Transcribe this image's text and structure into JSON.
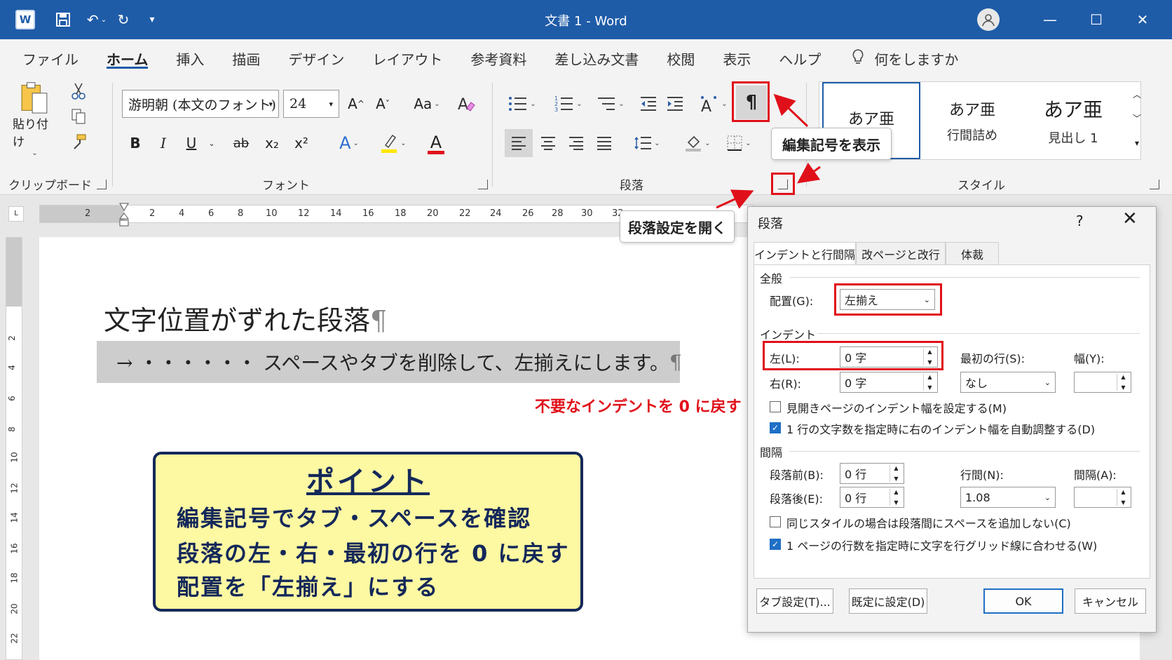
{
  "titlebar": {
    "title": "文書 1  -  Word",
    "logo": "W",
    "undo": "↶",
    "redo": "↻",
    "qat_more": "▾",
    "minimize": "—",
    "maximize": "☐",
    "close": "✕"
  },
  "menu": [
    "ファイル",
    "ホーム",
    "挿入",
    "描画",
    "デザイン",
    "レイアウト",
    "参考資料",
    "差し込み文書",
    "校閲",
    "表示",
    "ヘルプ",
    "何をしますか"
  ],
  "ribbon": {
    "clipboard": {
      "paste": "貼り付け",
      "label": "クリップボード"
    },
    "font": {
      "name": "游明朝 (本文のフォント)",
      "size": "24",
      "grow": "A^",
      "shrink": "A˅",
      "case": "Aa",
      "bold": "B",
      "italic": "I",
      "underline": "U",
      "strike": "ab",
      "sub": "x₂",
      "sup": "x²",
      "label": "フォント"
    },
    "paragraph": {
      "show_marks": "¶",
      "label": "段落"
    },
    "styles": {
      "items": [
        {
          "sample": "あア亜",
          "name": ""
        },
        {
          "sample": "あア亜",
          "name": "行間詰め"
        },
        {
          "sample": "あア亜",
          "name": "見出し 1"
        }
      ],
      "label": "スタイル"
    }
  },
  "callouts": {
    "show_marks": "編集記号を表示",
    "open_paragraph": "段落設定を開く"
  },
  "ruler": {
    "numbers": [
      "2",
      "2",
      "4",
      "6",
      "8",
      "10",
      "12",
      "14",
      "16",
      "18",
      "20",
      "22",
      "24",
      "26",
      "28",
      "30",
      "32"
    ],
    "vertical": [
      "2",
      "4",
      "6",
      "8",
      "10",
      "12",
      "14",
      "16",
      "18",
      "20",
      "22"
    ]
  },
  "document": {
    "heading": "文字位置がずれた段落",
    "pilcrow": "¶",
    "line2": "→  ・・・・・・ スペースやタブを削除して、左揃えにします。",
    "note": "不要なインデントを 0 に戻す",
    "point": {
      "title": "ポイント",
      "lines": [
        "編集記号でタブ・スペースを確認",
        "段落の左・右・最初の行を 0 に戻す",
        "配置を「左揃え」にする"
      ]
    }
  },
  "dialog": {
    "title": "段落",
    "help": "?",
    "close": "✕",
    "tabs": [
      "インデントと行間隔",
      "改ページと改行",
      "体裁"
    ],
    "general": {
      "section": "全般",
      "alignment_label": "配置(G):",
      "alignment_value": "左揃え"
    },
    "indent": {
      "section": "インデント",
      "left_label": "左(L):",
      "left_value": "0 字",
      "right_label": "右(R):",
      "right_value": "0 字",
      "first_label": "最初の行(S):",
      "first_value": "なし",
      "width_label": "幅(Y):",
      "width_value": "",
      "mirror": "見開きページのインデント幅を設定する(M)",
      "auto_adjust": "1 行の文字数を指定時に右のインデント幅を自動調整する(D)"
    },
    "spacing": {
      "section": "間隔",
      "before_label": "段落前(B):",
      "before_value": "0 行",
      "after_label": "段落後(E):",
      "after_value": "0 行",
      "line_label": "行間(N):",
      "line_value": "1.08",
      "at_label": "間隔(A):",
      "at_value": "",
      "no_space": "同じスタイルの場合は段落間にスペースを追加しない(C)",
      "snap_grid": "1 ページの行数を指定時に文字を行グリッド線に合わせる(W)"
    },
    "buttons": {
      "tabs": "タブ設定(T)...",
      "default": "既定に設定(D)",
      "ok": "OK",
      "cancel": "キャンセル"
    }
  },
  "colors": {
    "titlebar": "#1f5ca8",
    "highlight_red": "#e0101a",
    "point_bg": "#fdf8a2",
    "point_text": "#14285a"
  }
}
